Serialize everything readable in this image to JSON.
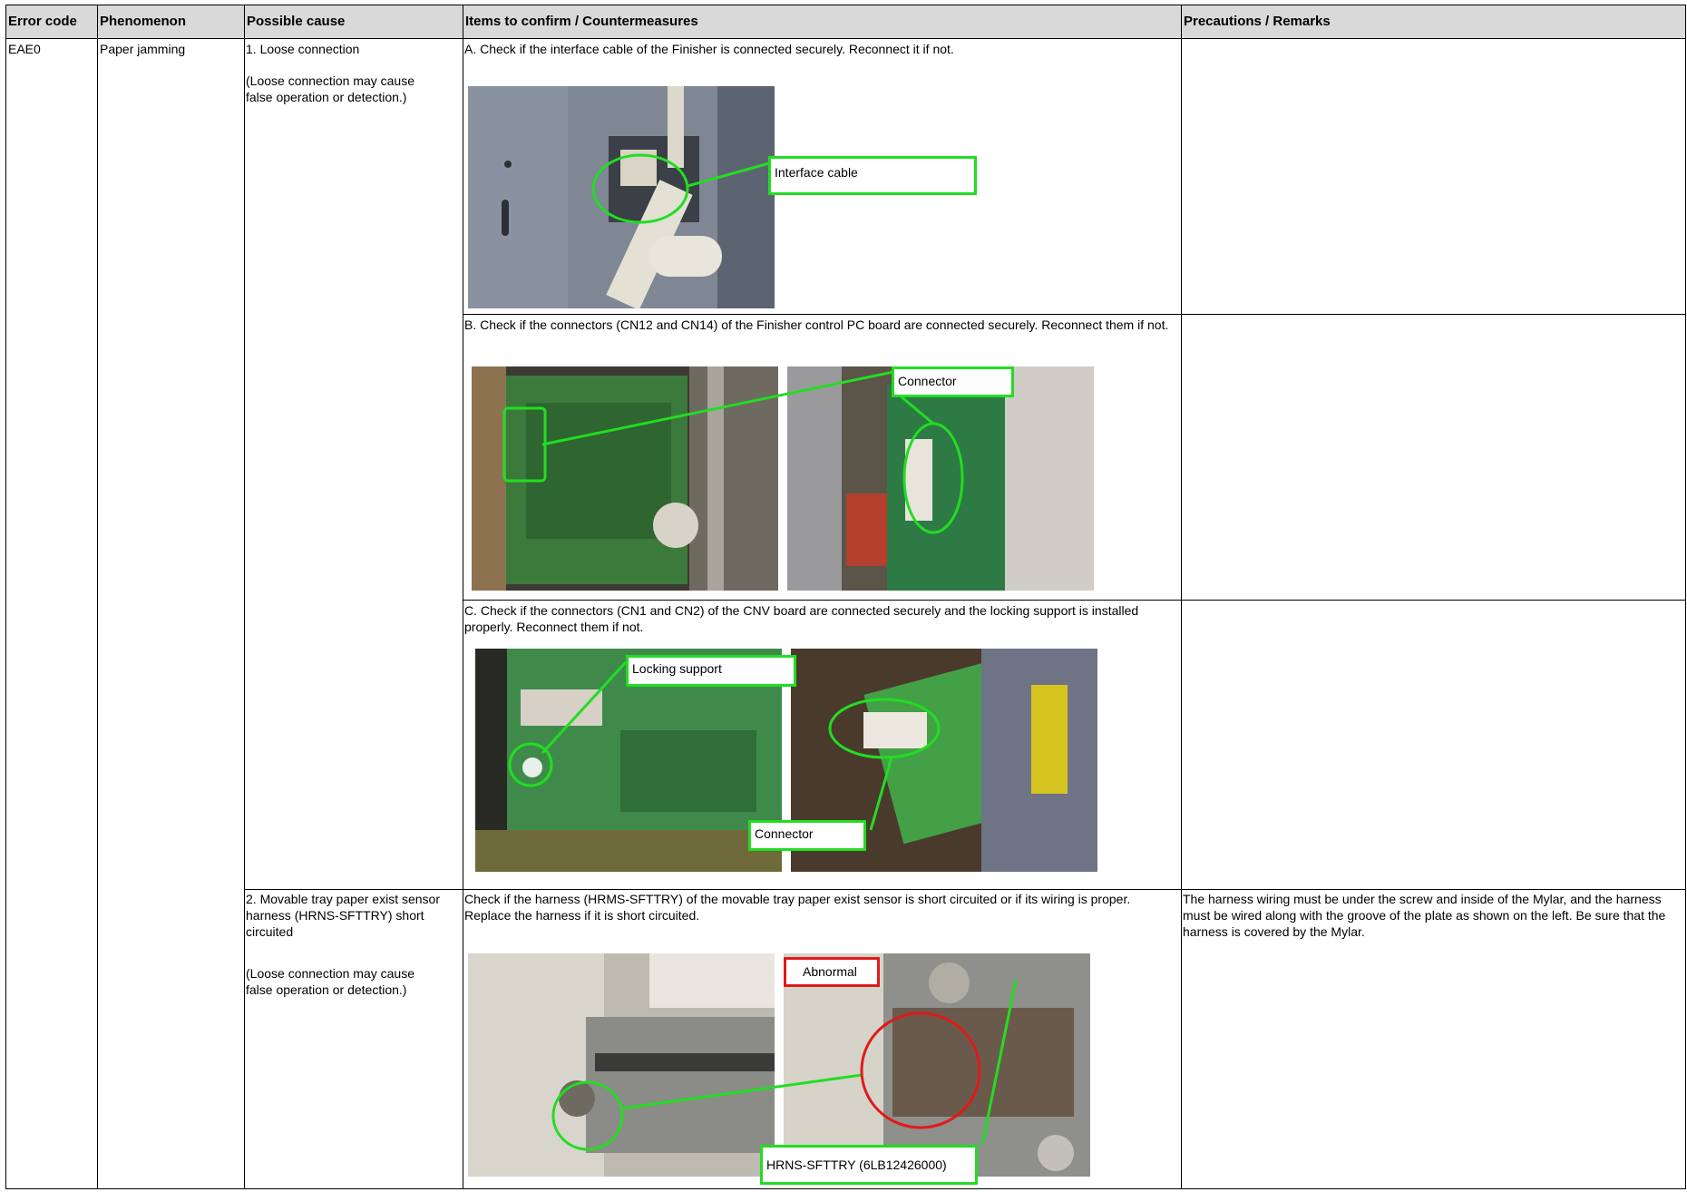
{
  "table": {
    "headers": {
      "error_code": "Error code",
      "phenomenon": "Phenomenon",
      "possible_cause": "Possible cause",
      "countermeasures": "Items to confirm / Countermeasures",
      "remarks": "Precautions / Remarks"
    },
    "row": {
      "error_code": "EAE0",
      "phenomenon": "Paper jamming"
    },
    "causes": [
      {
        "title": "1. Loose connection",
        "note": "(Loose connection may cause false operation or detection.)"
      },
      {
        "title": "2. Movable tray paper exist sensor harness (HRNS-SFTTRY) short circuited",
        "note": "(Loose connection may cause false operation or detection.)"
      }
    ],
    "checks": {
      "a": {
        "text": "A. Check if the interface cable of the Finisher is connected securely. Reconnect it if not.",
        "callout": "Interface cable"
      },
      "b": {
        "text": "B. Check if the connectors (CN12 and CN14) of the Finisher control PC board are connected securely. Reconnect them if not.",
        "callout": "Connector"
      },
      "c": {
        "text": "C. Check if the connectors (CN1 and CN2) of the CNV board are connected securely and the locking support is installed properly. Reconnect them if not.",
        "callout_lock": "Locking support",
        "callout_conn": "Connector"
      },
      "d": {
        "text": "Check if the harness (HRMS-SFTTRY) of the movable tray paper exist sensor is short circuited or if its wiring is proper. Replace the harness if it is short circuited.",
        "callout_abnormal": "Abnormal",
        "callout_part": "HRNS-SFTTRY (6LB12426000)"
      }
    },
    "remarks": {
      "d": "The harness wiring must be under the screw and inside of the Mylar, and the harness must be wired along with the groove of the plate as shown on the left. Be sure that the harness is covered by the Mylar."
    }
  },
  "colors": {
    "callout_green": "#22dd22",
    "callout_red": "#e01a1a",
    "header_bg": "#d9d9d9"
  }
}
